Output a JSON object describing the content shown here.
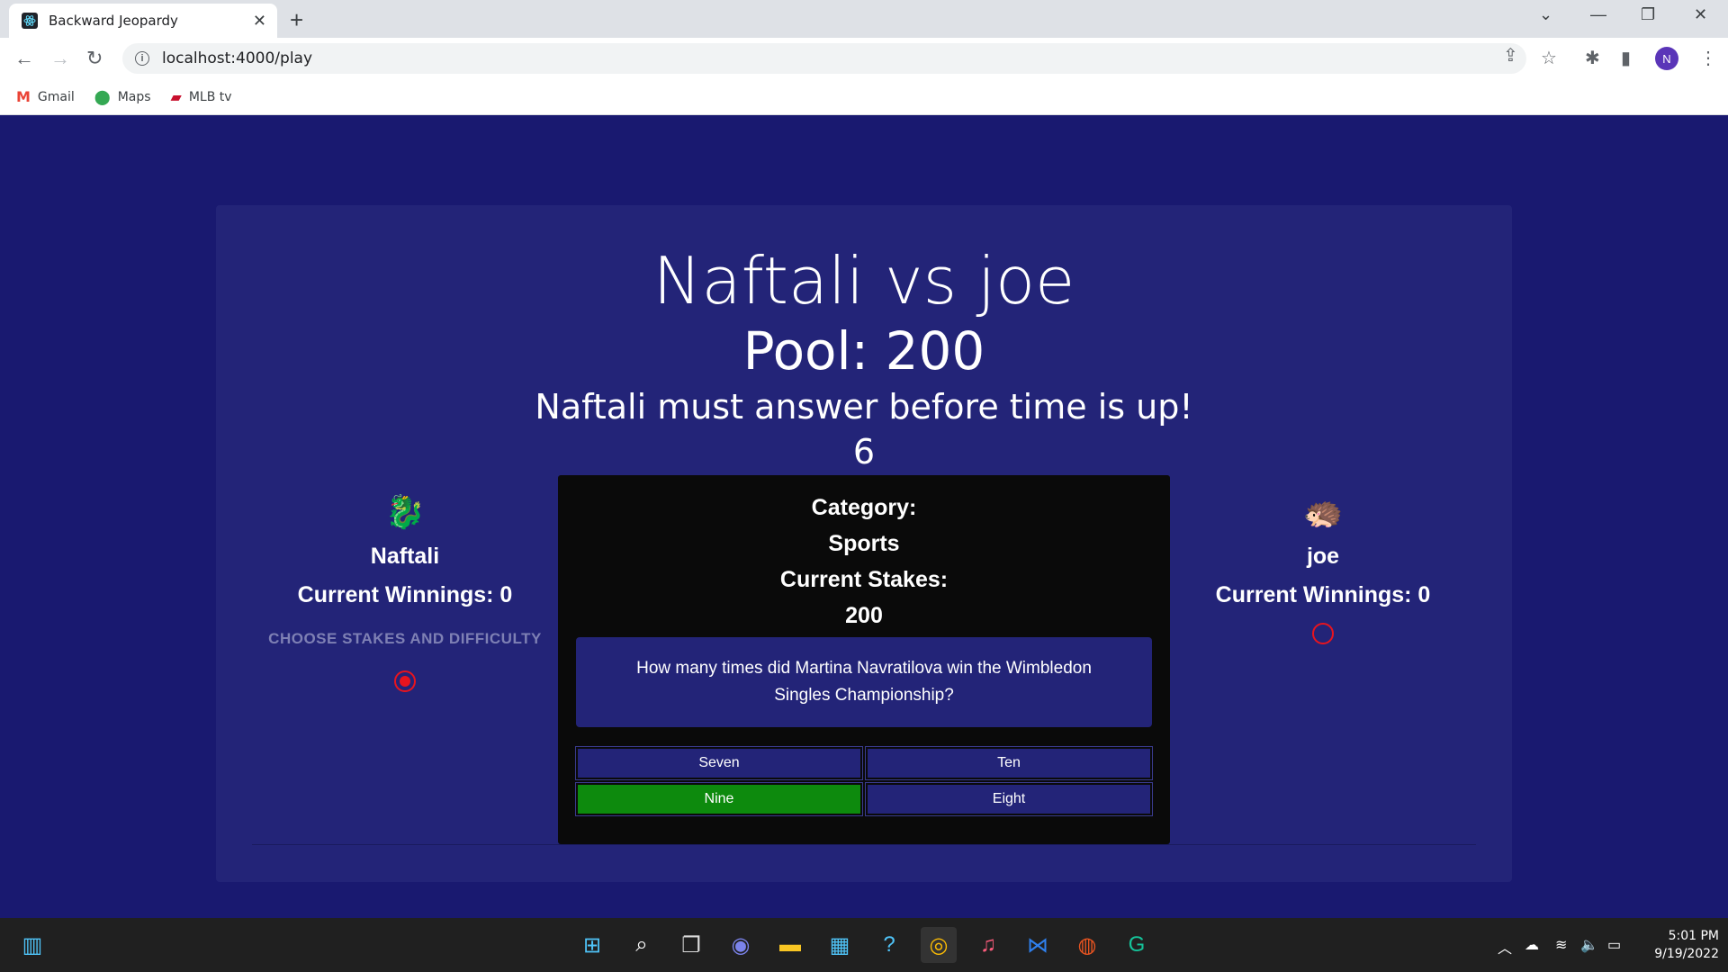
{
  "browser": {
    "tab_title": "Backward Jeopardy",
    "url": "localhost:4000/play",
    "profile_initial": "N",
    "bookmarks": [
      {
        "label": "Gmail",
        "icon": "gmail-icon"
      },
      {
        "label": "Maps",
        "icon": "maps-icon"
      },
      {
        "label": "MLB tv",
        "icon": "mlb-icon"
      }
    ]
  },
  "game": {
    "title": "Naftali vs joe",
    "pool": "Pool: 200",
    "status": "Naftali must answer before time is up!",
    "timer": "6"
  },
  "players": [
    {
      "name": "Naftali",
      "winnings": "Current Winnings: 0",
      "hint": "CHOOSE STAKES AND DIFFICULTY",
      "avatar": "dragon-icon",
      "selected": true
    },
    {
      "name": "joe",
      "winnings": "Current Winnings: 0",
      "avatar": "creature-icon",
      "selected": false
    }
  ],
  "question": {
    "category_label": "Category:",
    "category": "Sports",
    "stakes_label": "Current Stakes:",
    "stakes": "200",
    "text": "How many times did Martina Navratilova win the Wimbledon Singles Championship?",
    "answers": [
      "Seven",
      "Ten",
      "Nine",
      "Eight"
    ],
    "correct": "Nine"
  },
  "colors": {
    "background": "#191970",
    "card": "#232478",
    "correct": "#0d8a0d",
    "radio": "#e8141e"
  },
  "taskbar": {
    "time": "5:01 PM",
    "date": "9/19/2022"
  }
}
